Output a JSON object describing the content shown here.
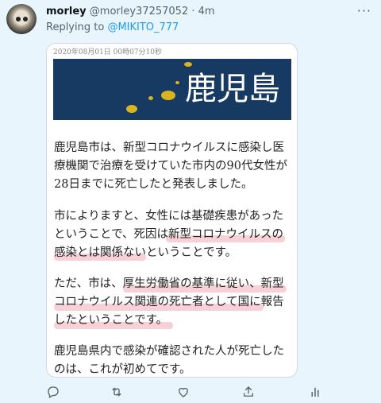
{
  "tweet": {
    "display_name": "morley",
    "handle": "@morley37257052",
    "separator": "·",
    "time": "4m",
    "replying_label": "Replying to",
    "replying_handle": "@MIKITO_777",
    "more_icon": "more-icon"
  },
  "image": {
    "timestamp": "2020年08月01日 00時07分10秒",
    "banner_title": "鹿児島",
    "paragraphs": [
      "鹿児島市は、新型コロナウイルスに感染し医療機関で治療を受けていた市内の90代女性が28日までに死亡したと発表しました。",
      "市によりますと、女性には基礎疾患があったということで、死因は新型コロナウイルスの感染とは関係ないということです。",
      "ただ、市は、厚生労働省の基準に従い、新型コロナウイルス関連の死亡者として国に報告したということです。",
      "鹿児島県内で感染が確認された人が死亡したのは、これが初めてです。"
    ]
  },
  "actions": [
    {
      "name": "reply",
      "icon": "reply-icon"
    },
    {
      "name": "retweet",
      "icon": "retweet-icon"
    },
    {
      "name": "like",
      "icon": "heart-icon"
    },
    {
      "name": "share",
      "icon": "share-icon"
    },
    {
      "name": "analytics",
      "icon": "analytics-icon"
    }
  ]
}
